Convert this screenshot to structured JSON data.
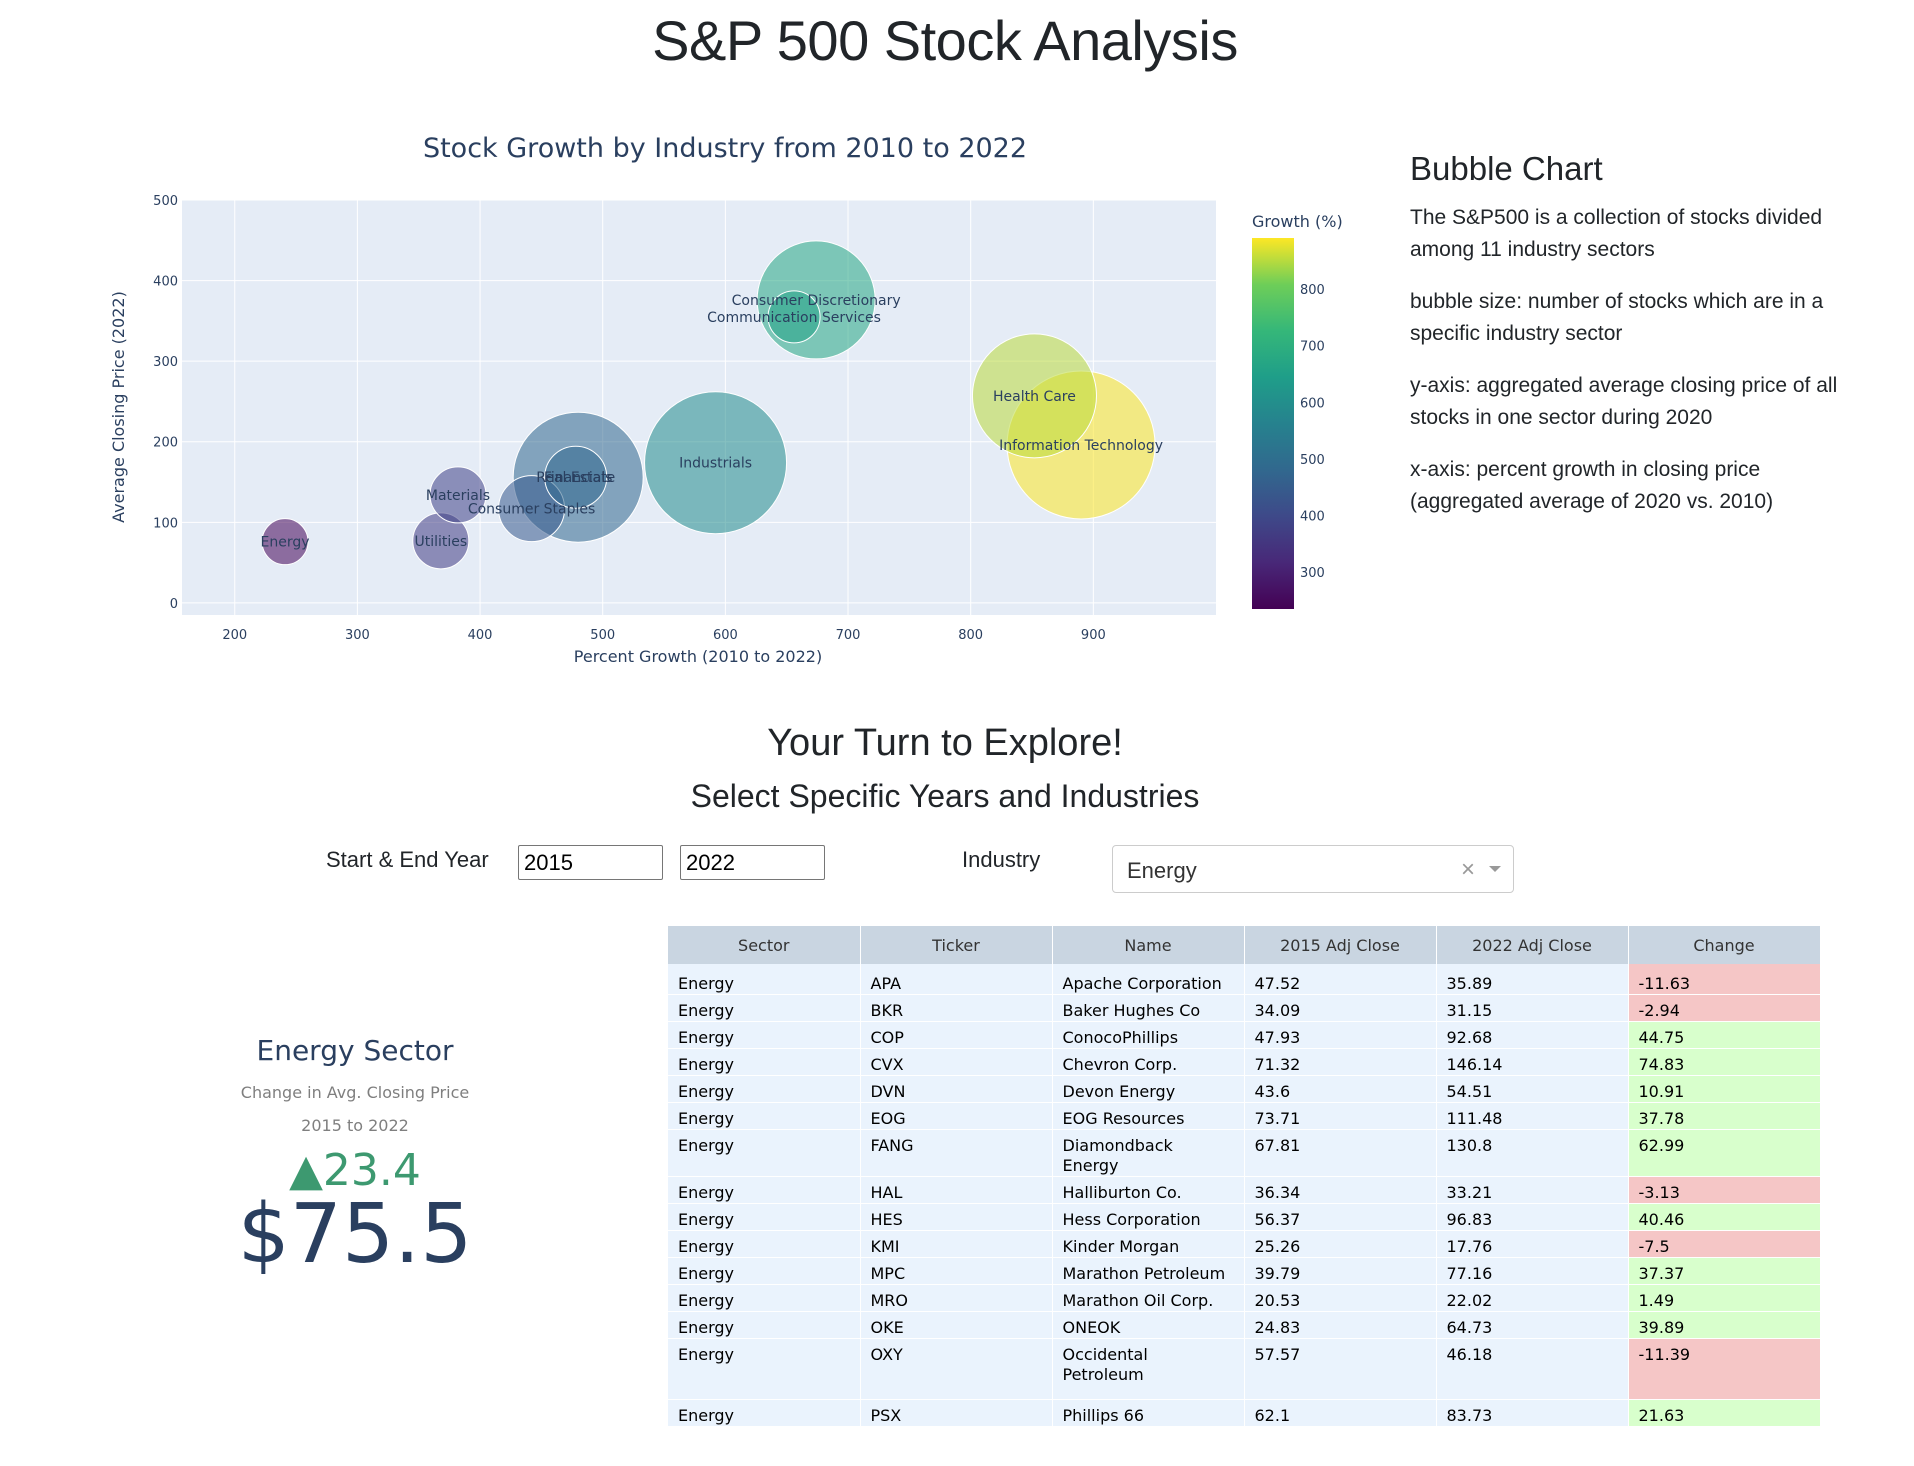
{
  "page": {
    "title": "S&P 500 Stock Analysis"
  },
  "chart_data": {
    "type": "scatter",
    "title": "Stock Growth by Industry from 2010 to 2022",
    "xlabel": "Percent Growth (2010 to 2022)",
    "ylabel": "Average Closing Price (2022)",
    "xlim": [
      157,
      1000
    ],
    "ylim": [
      -15,
      500
    ],
    "xticks": [
      200,
      300,
      400,
      500,
      600,
      700,
      800,
      900
    ],
    "yticks": [
      0,
      100,
      200,
      300,
      400,
      500
    ],
    "grid": true,
    "colorbar": {
      "title": "Growth (%)",
      "ticks": [
        300,
        400,
        500,
        600,
        700,
        800
      ],
      "range": [
        235,
        890
      ],
      "colorscale": "viridis"
    },
    "points": [
      {
        "label": "Energy",
        "x": 241,
        "y": 76,
        "size": 23
      },
      {
        "label": "Utilities",
        "x": 368,
        "y": 77,
        "size": 28
      },
      {
        "label": "Materials",
        "x": 382,
        "y": 134,
        "size": 28
      },
      {
        "label": "Consumer Staples",
        "x": 442,
        "y": 117,
        "size": 33
      },
      {
        "label": "Financials",
        "x": 480,
        "y": 156,
        "size": 65
      },
      {
        "label": "Real Estate",
        "x": 478,
        "y": 156,
        "size": 31
      },
      {
        "label": "Industrials",
        "x": 592,
        "y": 174,
        "size": 71
      },
      {
        "label": "Communication Services",
        "x": 656,
        "y": 355,
        "size": 26
      },
      {
        "label": "Consumer Discretionary",
        "x": 674,
        "y": 376,
        "size": 59
      },
      {
        "label": "Health Care",
        "x": 852,
        "y": 257,
        "size": 62
      },
      {
        "label": "Information Technology",
        "x": 890,
        "y": 196,
        "size": 74
      }
    ]
  },
  "side": {
    "title": "Bubble Chart",
    "p1": "The S&P500 is a collection of stocks divided among 11 industry sectors",
    "p2": "bubble size: number of stocks which are in a specific industry sector",
    "p3": "y-axis: aggregated average closing price of all stocks in one sector during 2020",
    "p4": "x-axis: percent growth in closing price (aggregated average of 2020 vs. 2010)"
  },
  "explore": {
    "title": "Your Turn to Explore!",
    "subtitle": "Select Specific Years and Industries",
    "year_label": "Start & End Year",
    "start_year": "2015",
    "end_year": "2022",
    "industry_label": "Industry",
    "industry_value": "Energy",
    "clear_glyph": "×"
  },
  "indicator": {
    "title": "Energy Sector",
    "subtitle1": "Change in Avg. Closing Price",
    "subtitle2": "2015 to 2022",
    "delta": "▲23.4",
    "value": "$75.5"
  },
  "table": {
    "headers": [
      "Sector",
      "Ticker",
      "Name",
      "2015 Adj Close",
      "2022 Adj Close",
      "Change"
    ],
    "rows": [
      [
        "Energy",
        "APA",
        "Apache Corporation",
        "47.52",
        "35.89",
        "-11.63"
      ],
      [
        "Energy",
        "BKR",
        "Baker Hughes Co",
        "34.09",
        "31.15",
        "-2.94"
      ],
      [
        "Energy",
        "COP",
        "ConocoPhillips",
        "47.93",
        "92.68",
        "44.75"
      ],
      [
        "Energy",
        "CVX",
        "Chevron Corp.",
        "71.32",
        "146.14",
        "74.83"
      ],
      [
        "Energy",
        "DVN",
        "Devon Energy",
        "43.6",
        "54.51",
        "10.91"
      ],
      [
        "Energy",
        "EOG",
        "EOG Resources",
        "73.71",
        "111.48",
        "37.78"
      ],
      [
        "Energy",
        "FANG",
        "Diamondback Energy",
        "67.81",
        "130.8",
        "62.99"
      ],
      [
        "Energy",
        "HAL",
        "Halliburton Co.",
        "36.34",
        "33.21",
        "-3.13"
      ],
      [
        "Energy",
        "HES",
        "Hess Corporation",
        "56.37",
        "96.83",
        "40.46"
      ],
      [
        "Energy",
        "KMI",
        "Kinder Morgan",
        "25.26",
        "17.76",
        "-7.5"
      ],
      [
        "Energy",
        "MPC",
        "Marathon Petroleum",
        "39.79",
        "77.16",
        "37.37"
      ],
      [
        "Energy",
        "MRO",
        "Marathon Oil Corp.",
        "20.53",
        "22.02",
        "1.49"
      ],
      [
        "Energy",
        "OKE",
        "ONEOK",
        "24.83",
        "64.73",
        "39.89"
      ],
      [
        "Energy",
        "OXY",
        "Occidental Petroleum",
        "57.57",
        "46.18",
        "-11.39"
      ],
      [
        "Energy",
        "PSX",
        "Phillips 66",
        "62.1",
        "83.73",
        "21.63"
      ]
    ]
  }
}
